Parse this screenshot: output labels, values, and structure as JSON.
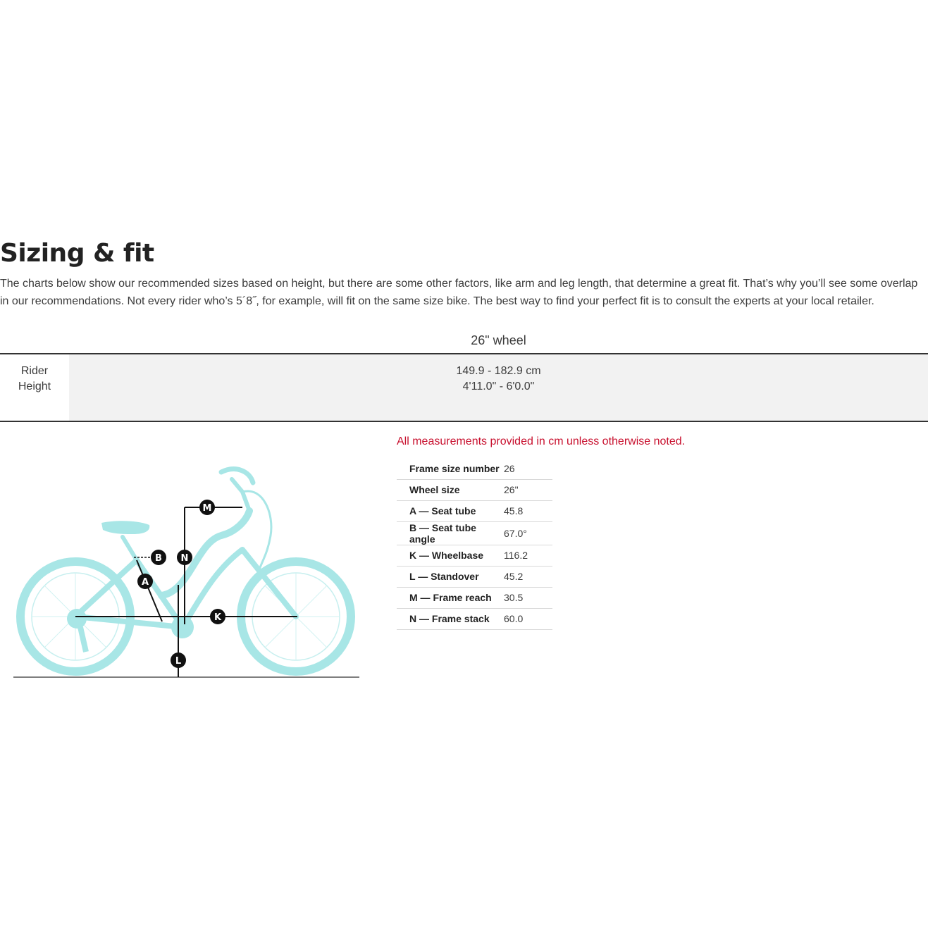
{
  "section": {
    "title": "Sizing & fit",
    "intro": "The charts below show our recommended sizes based on height, but there are some other factors, like arm and leg length, that determine a great fit. That’s why you’ll see some overlap in our recommendations. Not every rider who’s 5´8˝, for example, will fit on the same size bike. The best way to find your perfect fit is to consult the experts at your local retailer."
  },
  "size_table": {
    "column": "26\" wheel",
    "row_label_line1": "Rider",
    "row_label_line2": "Height",
    "cm": "149.9 - 182.9 cm",
    "ftin": "4'11.0\" - 6'0.0\""
  },
  "geometry": {
    "note": "All measurements provided in cm unless otherwise noted.",
    "rows": [
      {
        "label": "Frame size number",
        "value": "26"
      },
      {
        "label": "Wheel size",
        "value": "26\""
      },
      {
        "label": "A — Seat tube",
        "value": "45.8"
      },
      {
        "label": "B — Seat tube angle",
        "value": "67.0°"
      },
      {
        "label": "K — Wheelbase",
        "value": "116.2"
      },
      {
        "label": "L — Standover",
        "value": "45.2"
      },
      {
        "label": "M — Frame reach",
        "value": "30.5"
      },
      {
        "label": "N — Frame stack",
        "value": "60.0"
      }
    ]
  },
  "diagram": {
    "bike_color": "#a8e6e6",
    "markers": [
      "M",
      "B",
      "N",
      "A",
      "K",
      "L"
    ]
  },
  "colors": {
    "note_red": "#c8102e",
    "title": "#222222"
  }
}
